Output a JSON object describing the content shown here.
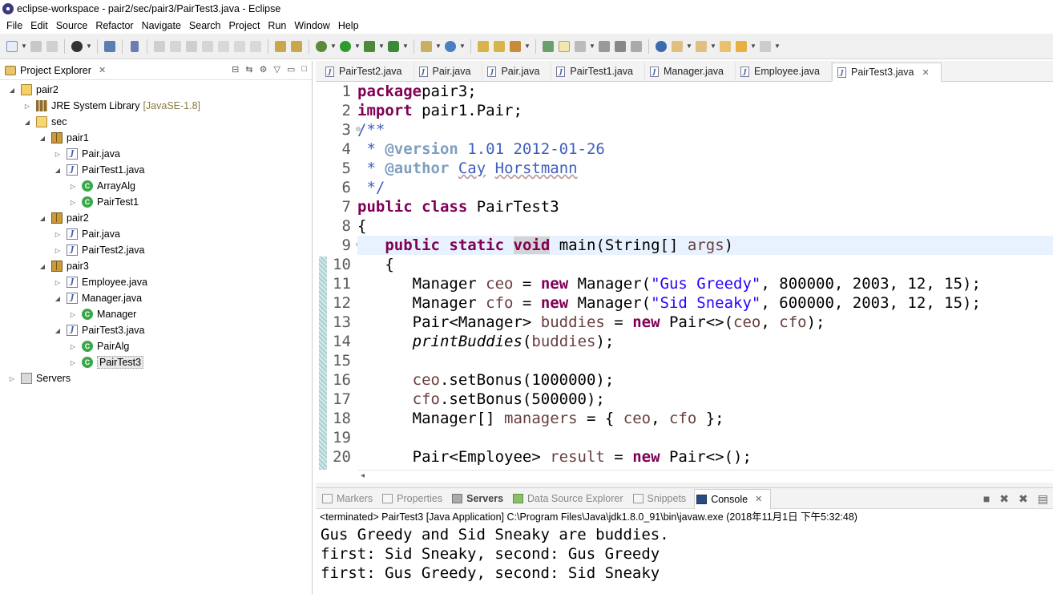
{
  "window": {
    "title": "eclipse-workspace - pair2/sec/pair3/PairTest3.java - Eclipse"
  },
  "menu": [
    "File",
    "Edit",
    "Source",
    "Refactor",
    "Navigate",
    "Search",
    "Project",
    "Run",
    "Window",
    "Help"
  ],
  "project_explorer": {
    "title": "Project Explorer",
    "tree": [
      {
        "label": "pair2",
        "icon": "project-icon",
        "level": 0,
        "twisty": "expanded"
      },
      {
        "label": "JRE System Library",
        "muted": "[JavaSE-1.8]",
        "icon": "library-icon",
        "level": 1,
        "twisty": "collapsed"
      },
      {
        "label": "sec",
        "icon": "source-folder-icon",
        "level": 1,
        "twisty": "expanded"
      },
      {
        "label": "pair1",
        "icon": "package-icon",
        "level": 2,
        "twisty": "expanded"
      },
      {
        "label": "Pair.java",
        "icon": "java-file-icon",
        "level": 3,
        "twisty": "collapsed"
      },
      {
        "label": "PairTest1.java",
        "icon": "java-file-icon",
        "level": 3,
        "twisty": "expanded"
      },
      {
        "label": "ArrayAlg",
        "icon": "class-icon",
        "level": 4,
        "twisty": "collapsed"
      },
      {
        "label": "PairTest1",
        "icon": "class-icon",
        "level": 4,
        "twisty": "collapsed"
      },
      {
        "label": "pair2",
        "icon": "package-icon",
        "level": 2,
        "twisty": "expanded"
      },
      {
        "label": "Pair.java",
        "icon": "java-file-icon",
        "level": 3,
        "twisty": "collapsed"
      },
      {
        "label": "PairTest2.java",
        "icon": "java-file-icon",
        "level": 3,
        "twisty": "collapsed"
      },
      {
        "label": "pair3",
        "icon": "package-icon",
        "level": 2,
        "twisty": "expanded"
      },
      {
        "label": "Employee.java",
        "icon": "java-file-icon",
        "level": 3,
        "twisty": "collapsed"
      },
      {
        "label": "Manager.java",
        "icon": "java-file-icon",
        "level": 3,
        "twisty": "expanded"
      },
      {
        "label": "Manager",
        "icon": "class-icon",
        "level": 4,
        "twisty": "collapsed"
      },
      {
        "label": "PairTest3.java",
        "icon": "java-file-icon",
        "level": 3,
        "twisty": "expanded"
      },
      {
        "label": "PairAlg",
        "icon": "class-icon",
        "level": 4,
        "twisty": "collapsed"
      },
      {
        "label": "PairTest3",
        "icon": "class-icon",
        "level": 4,
        "twisty": "collapsed",
        "selected": true
      },
      {
        "label": "Servers",
        "icon": "servers-folder-icon",
        "level": 0,
        "twisty": "collapsed"
      }
    ]
  },
  "editor": {
    "tabs": [
      {
        "label": "PairTest2.java",
        "active": false
      },
      {
        "label": "Pair.java",
        "active": false
      },
      {
        "label": "Pair.java",
        "active": false
      },
      {
        "label": "PairTest1.java",
        "active": false
      },
      {
        "label": "Manager.java",
        "active": false
      },
      {
        "label": "Employee.java",
        "active": false
      },
      {
        "label": "PairTest3.java",
        "active": true
      }
    ],
    "current_line": 9,
    "lines": [
      {
        "n": 1,
        "t": [
          [
            "kw",
            "package"
          ],
          [
            "",
            "pair3;"
          ]
        ]
      },
      {
        "n": 2,
        "t": [
          [
            "kw",
            "import"
          ],
          [
            "",
            " pair1.Pair;"
          ]
        ]
      },
      {
        "n": 3,
        "fold": true,
        "t": [
          [
            "cmt",
            "/**"
          ]
        ]
      },
      {
        "n": 4,
        "t": [
          [
            "cmt",
            " * "
          ],
          [
            "tag",
            "@version"
          ],
          [
            "cmt",
            " 1.01 2012-01-26"
          ]
        ]
      },
      {
        "n": 5,
        "t": [
          [
            "cmt",
            " * "
          ],
          [
            "tag",
            "@author"
          ],
          [
            "cmt",
            " "
          ],
          [
            "cmt squig",
            "Cay"
          ],
          [
            "cmt",
            " "
          ],
          [
            "cmt squig",
            "Horstmann"
          ]
        ]
      },
      {
        "n": 6,
        "t": [
          [
            "cmt",
            " */"
          ]
        ]
      },
      {
        "n": 7,
        "t": [
          [
            "kw",
            "public"
          ],
          [
            "",
            " "
          ],
          [
            "kw",
            "class"
          ],
          [
            "",
            " PairTest3"
          ]
        ]
      },
      {
        "n": 8,
        "t": [
          [
            "",
            "{"
          ]
        ]
      },
      {
        "n": 9,
        "fold": true,
        "t": [
          [
            "",
            "   "
          ],
          [
            "kw",
            "public"
          ],
          [
            "",
            " "
          ],
          [
            "kw",
            "static"
          ],
          [
            "",
            " "
          ],
          [
            "kw hl",
            "void"
          ],
          [
            "",
            " main(String[] "
          ],
          [
            "fld",
            "args"
          ],
          [
            "",
            ")"
          ]
        ]
      },
      {
        "n": 10,
        "t": [
          [
            "",
            "   {"
          ]
        ]
      },
      {
        "n": 11,
        "t": [
          [
            "",
            "      Manager "
          ],
          [
            "fld",
            "ceo"
          ],
          [
            "",
            " = "
          ],
          [
            "kw",
            "new"
          ],
          [
            "",
            " Manager("
          ],
          [
            "str",
            "\"Gus Greedy\""
          ],
          [
            "",
            ", 800000, 2003, 12, 15);"
          ]
        ]
      },
      {
        "n": 12,
        "t": [
          [
            "",
            "      Manager "
          ],
          [
            "fld",
            "cfo"
          ],
          [
            "",
            " = "
          ],
          [
            "kw",
            "new"
          ],
          [
            "",
            " Manager("
          ],
          [
            "str",
            "\"Sid Sneaky\""
          ],
          [
            "",
            ", 600000, 2003, 12, 15);"
          ]
        ]
      },
      {
        "n": 13,
        "t": [
          [
            "",
            "      Pair<Manager> "
          ],
          [
            "fld",
            "buddies"
          ],
          [
            "",
            " = "
          ],
          [
            "kw",
            "new"
          ],
          [
            "",
            " Pair<>("
          ],
          [
            "fld",
            "ceo"
          ],
          [
            "",
            ", "
          ],
          [
            "fld",
            "cfo"
          ],
          [
            "",
            ");"
          ]
        ]
      },
      {
        "n": 14,
        "t": [
          [
            "",
            "      "
          ],
          [
            "ital",
            "printBuddies"
          ],
          [
            "",
            "("
          ],
          [
            "fld",
            "buddies"
          ],
          [
            "",
            ");"
          ]
        ]
      },
      {
        "n": 15,
        "t": [
          [
            "",
            ""
          ]
        ]
      },
      {
        "n": 16,
        "t": [
          [
            "",
            "      "
          ],
          [
            "fld",
            "ceo"
          ],
          [
            "",
            ".setBonus(1000000);"
          ]
        ]
      },
      {
        "n": 17,
        "t": [
          [
            "",
            "      "
          ],
          [
            "fld",
            "cfo"
          ],
          [
            "",
            ".setBonus(500000);"
          ]
        ]
      },
      {
        "n": 18,
        "t": [
          [
            "",
            "      Manager[] "
          ],
          [
            "fld",
            "managers"
          ],
          [
            "",
            " = { "
          ],
          [
            "fld",
            "ceo"
          ],
          [
            "",
            ", "
          ],
          [
            "fld",
            "cfo"
          ],
          [
            "",
            " };"
          ]
        ]
      },
      {
        "n": 19,
        "t": [
          [
            "",
            ""
          ]
        ]
      },
      {
        "n": 20,
        "t": [
          [
            "",
            "      Pair<Employee> "
          ],
          [
            "fld",
            "result"
          ],
          [
            "",
            " = "
          ],
          [
            "kw",
            "new"
          ],
          [
            "",
            " Pair<>();"
          ]
        ]
      }
    ]
  },
  "console_panel": {
    "tabs": [
      {
        "label": "Markers",
        "icon": "markers-icon",
        "style": "dim"
      },
      {
        "label": "Properties",
        "icon": "properties-icon",
        "style": "dim"
      },
      {
        "label": "Servers",
        "icon": "servers-icon",
        "style": "bold"
      },
      {
        "label": "Data Source Explorer",
        "icon": "data-source-icon",
        "style": "dim"
      },
      {
        "label": "Snippets",
        "icon": "snippets-icon",
        "style": "dim"
      },
      {
        "label": "Console",
        "icon": "console-icon",
        "style": "active"
      }
    ],
    "status": "<terminated> PairTest3 [Java Application] C:\\Program Files\\Java\\jdk1.8.0_91\\bin\\javaw.exe (2018年11月1日 下午5:32:48)",
    "output": [
      "Gus Greedy and Sid Sneaky are buddies.",
      "first: Sid Sneaky, second: Gus Greedy",
      "first: Gus Greedy, second: Sid Sneaky"
    ]
  }
}
